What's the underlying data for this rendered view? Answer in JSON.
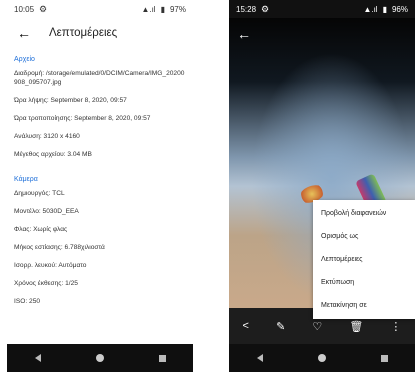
{
  "left": {
    "status": {
      "time": "10:05",
      "battery": "97%"
    },
    "title": "Λεπτομέρειες",
    "file_section": {
      "header": "Αρχείο",
      "rows": [
        "Διαδρομή: /storage/emulated/0/DCIM/Camera/IMG_20200908_095707.jpg",
        "Ώρα λήψης: September 8, 2020, 09:57",
        "Ώρα τροποποίησης: September 8, 2020, 09:57",
        "Ανάλυση: 3120 x 4160",
        "Μέγεθος αρχείου: 3.04 MB"
      ]
    },
    "camera_section": {
      "header": "Κάμερα",
      "rows": [
        "Δημιουργός: TCL",
        "Μοντέλο: 5030D_EEA",
        "Φλας: Χωρίς φλας",
        "Μήκος εστίασης: 6.788χιλιοστά",
        "Ισορρ. λευκού: Αυτόματο",
        "Χρόνος έκθεσης: 1/25",
        "ISO: 250"
      ]
    }
  },
  "right": {
    "status": {
      "time": "15:28",
      "battery": "96%"
    },
    "menu": [
      "Προβολή διαφανειών",
      "Ορισμός ως",
      "Λεπτομέρειες",
      "Εκτύπωση",
      "Μετακίνηση σε"
    ],
    "toolbar": {
      "icons": [
        "share-icon",
        "edit-icon",
        "favorite-icon",
        "delete-icon",
        "more-icon"
      ]
    }
  },
  "icons": {
    "back": "←",
    "gear": "⚙",
    "share": "<",
    "edit": "✎",
    "favorite": "♡",
    "delete": "🗑",
    "more": "⋮",
    "signal": "▲.ıl",
    "battery_prefix": "▮"
  }
}
